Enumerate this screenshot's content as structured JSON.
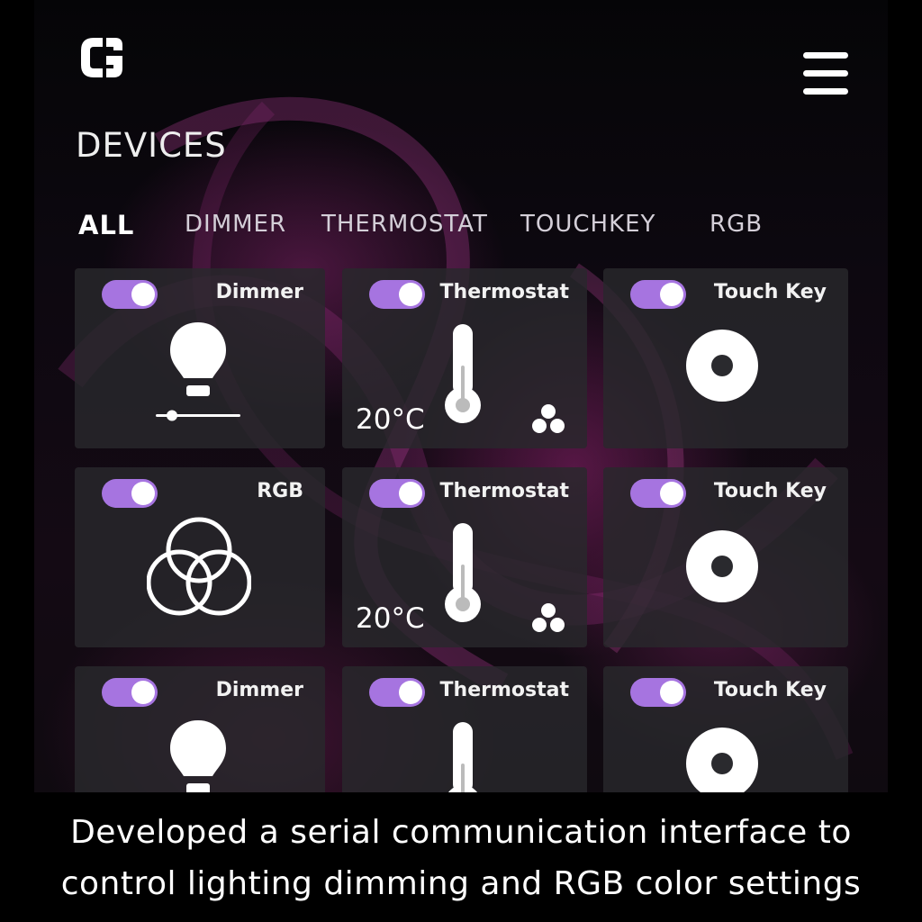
{
  "header": {
    "logo_icon": "g-logo-icon",
    "menu_icon": "hamburger-menu-icon"
  },
  "page_title": "DEVICES",
  "tabs": [
    {
      "label": "ALL",
      "active": true
    },
    {
      "label": "DIMMER",
      "active": false
    },
    {
      "label": "THERMOSTAT",
      "active": false
    },
    {
      "label": "TOUCHKEY",
      "active": false
    },
    {
      "label": "RGB",
      "active": false
    }
  ],
  "toggle_color": "#a674e0",
  "cards": [
    {
      "label": "Dimmer",
      "type": "dimmer",
      "icon": "light-bulb-icon",
      "on": true
    },
    {
      "label": "Thermostat",
      "type": "thermostat",
      "icon": "thermometer-icon",
      "temperature": "20°C",
      "on": true
    },
    {
      "label": "Touch Key",
      "type": "touchkey",
      "icon": "ring-button-icon",
      "on": true
    },
    {
      "label": "RGB",
      "type": "rgb",
      "icon": "rgb-circles-icon",
      "on": true
    },
    {
      "label": "Thermostat",
      "type": "thermostat",
      "icon": "thermometer-icon",
      "temperature": "20°C",
      "on": true
    },
    {
      "label": "Touch Key",
      "type": "touchkey",
      "icon": "ring-button-icon",
      "on": true
    },
    {
      "label": "Dimmer",
      "type": "dimmer",
      "icon": "light-bulb-icon",
      "on": true
    },
    {
      "label": "Thermostat",
      "type": "thermostat",
      "icon": "thermometer-icon",
      "on": true
    },
    {
      "label": "Touch Key",
      "type": "touchkey",
      "icon": "ring-button-icon",
      "on": true
    }
  ],
  "caption": {
    "line1": "Developed a serial communication interface to",
    "line2": "control lighting dimming and RGB color settings"
  }
}
